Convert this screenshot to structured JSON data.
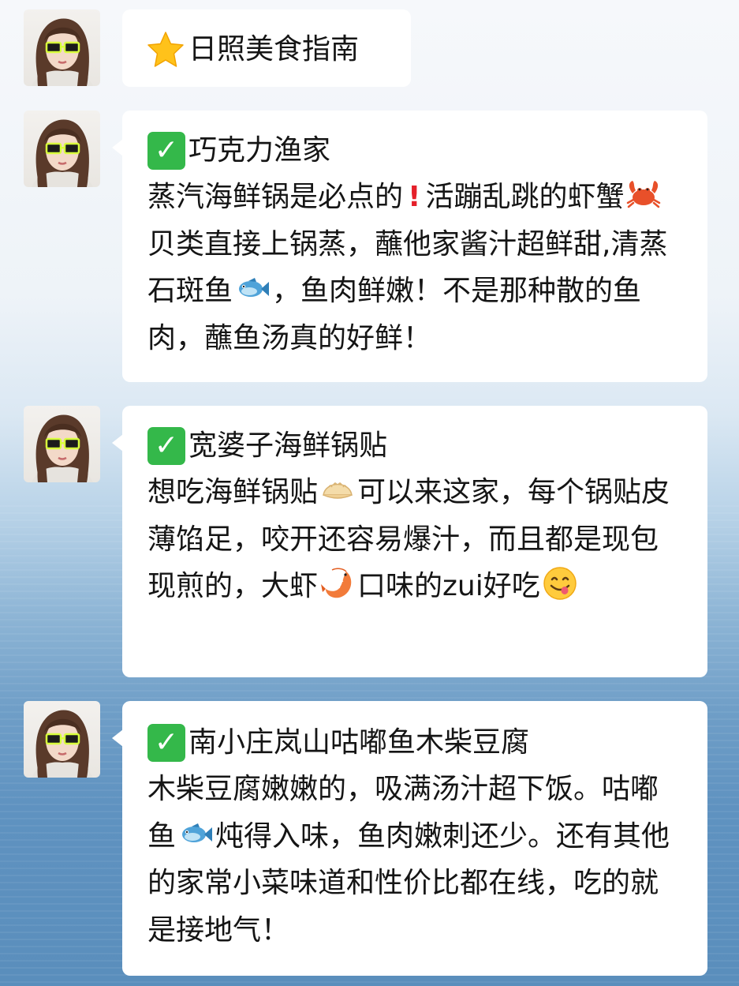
{
  "messages": [
    {
      "type": "title",
      "heading": "日照美食指南",
      "icon": "star-icon"
    },
    {
      "type": "restaurant",
      "heading": "巧克力渔家",
      "icon": "check-mark-icon",
      "body": {
        "p1": "蒸汽海鲜锅是必点的",
        "p2": "活蹦乱跳的虾蟹",
        "p3": "贝类直接上锅蒸，蘸他家酱汁超鲜甜,清蒸石斑鱼",
        "p4": "，鱼肉鲜嫩！不是那种散的鱼肉，蘸鱼汤真的好鲜！"
      }
    },
    {
      "type": "restaurant",
      "heading": "宽婆子海鲜锅贴",
      "icon": "check-mark-icon",
      "body": {
        "p1": "想吃海鲜锅贴",
        "p2": "可以来这家，每个锅贴皮薄馅足，咬开还容易爆汁，而且都是现包现煎的，大虾",
        "p3": "口味的zui好吃"
      }
    },
    {
      "type": "restaurant",
      "heading": "南小庄岚山咕嘟鱼木柴豆腐",
      "icon": "check-mark-icon",
      "body": {
        "p1": "木柴豆腐嫩嫩的，吸满汤汁超下饭。咕嘟鱼",
        "p2": "炖得入味，鱼肉嫩刺还少。还有其他的家常小菜味道和性价比都在线，吃的就是接地气！"
      }
    }
  ],
  "symbols": {
    "check": "✓",
    "exclaim": "!"
  },
  "colors": {
    "check_bg": "#34b84a",
    "exclaim": "#e5202a",
    "bubble_bg": "#ffffff"
  }
}
